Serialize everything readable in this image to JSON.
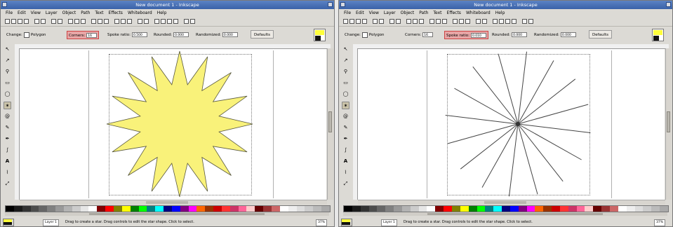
{
  "windows": [
    {
      "id": "left",
      "title": "New document 1 - Inkscape",
      "menu": [
        "File",
        "Edit",
        "View",
        "Layer",
        "Object",
        "Path",
        "Text",
        "Effects",
        "Whiteboard",
        "Help"
      ],
      "controls": {
        "change_label": "Change:",
        "polygon_label": "Polygon",
        "corners_label": "Corners:",
        "corners_value": "16",
        "spoke_label": "Spoke ratio:",
        "spoke_value": "0.500",
        "rounded_label": "Rounded:",
        "rounded_value": "0.000",
        "randomized_label": "Randomized:",
        "randomized_value": "0.000",
        "defaults_label": "Defaults",
        "highlight": "corners"
      },
      "status": {
        "layer": "Layer 1",
        "message": "Drag to create a star. Drag controls to edit the star shape. Click to select.",
        "zoom": "37%"
      },
      "shape": "star-filled"
    },
    {
      "id": "right",
      "title": "New document 1 - Inkscape",
      "menu": [
        "File",
        "Edit",
        "View",
        "Layer",
        "Object",
        "Path",
        "Text",
        "Effects",
        "Whiteboard",
        "Help"
      ],
      "controls": {
        "change_label": "Change:",
        "polygon_label": "Polygon",
        "corners_label": "Corners:",
        "corners_value": "16",
        "spoke_label": "Spoke ratio:",
        "spoke_value": "0.010",
        "rounded_label": "Rounded:",
        "rounded_value": "0.000",
        "randomized_label": "Randomized:",
        "randomized_value": "0.000",
        "defaults_label": "Defaults",
        "highlight": "spoke"
      },
      "status": {
        "layer": "Layer 1",
        "message": "Drag to create a star. Drag controls to edit the star shape. Click to select.",
        "zoom": "37%"
      },
      "shape": "star-spokes"
    }
  ],
  "colors": {
    "star_fill": "#f9f27a",
    "star_stroke": "#5a5a40",
    "highlight": "#e8a6a6",
    "title_bar": "#3a62a8"
  },
  "tools": [
    "selector-tool",
    "node-tool",
    "zoom-tool",
    "rect-tool",
    "ellipse-tool",
    "star-tool",
    "spiral-tool",
    "pencil-tool",
    "pen-tool",
    "calligraphy-tool",
    "text-tool",
    "dropper-tool",
    "connector-tool"
  ],
  "palette": [
    "#000000",
    "#1a1a1a",
    "#333333",
    "#4d4d4d",
    "#666666",
    "#808080",
    "#999999",
    "#b3b3b3",
    "#cccccc",
    "#e6e6e6",
    "#ffffff",
    "#800000",
    "#ff0000",
    "#808000",
    "#ffff00",
    "#008000",
    "#00ff00",
    "#008080",
    "#00ffff",
    "#000080",
    "#0000ff",
    "#800080",
    "#ff00ff",
    "#ff6600",
    "#993300",
    "#cc0000",
    "#ff3333",
    "#cc3366",
    "#ff6699",
    "#ffcccc",
    "#660000",
    "#993333",
    "#cc6666",
    "#ffffff",
    "#eeeeee",
    "#dddddd",
    "#cccccc",
    "#bbbbbb",
    "#aaaaaa"
  ]
}
